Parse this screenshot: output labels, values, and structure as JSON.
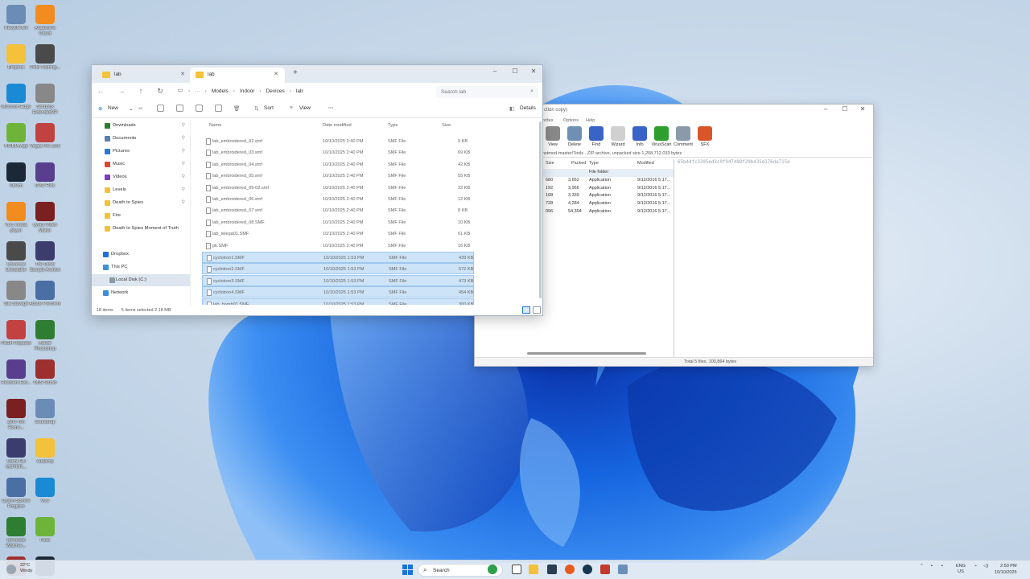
{
  "desktop": {
    "col1": [
      "Recycle Bin",
      "Dropbox",
      "Microsoft Edge",
      "NVIDIA App",
      "Steam",
      "VLC media player",
      "Universal Uninstaller",
      "Silk Salvage",
      "FitGirl Repacks",
      "Resident Evil...",
      "Zero Ton Rome...",
      "Silent Hill MOTOR...",
      "Dyson Sphere Program",
      "Universal Watcher...",
      "Lab/Thing Studio..."
    ],
    "col2": [
      "Assassin's Creed",
      "Field Training...",
      "Sandbox ExtendedVR",
      "Vegas Pro 20.0",
      "DVD Flick",
      "Lyrics Video Maker",
      "The Other Sample Archive",
      "Adobe Premiere",
      "Adobe Photoshop",
      "OBS Studio",
      "Soundtrap",
      "Audacity",
      "VLC",
      "Foxit",
      "Spotify"
    ]
  },
  "explorer": {
    "tabs": [
      {
        "label": "lab"
      },
      {
        "label": "lab"
      }
    ],
    "breadcrumbs": [
      "Models",
      "Indoor",
      "Devices",
      "lab"
    ],
    "search_placeholder": "Search lab",
    "toolbar": {
      "new": "New",
      "sort": "Sort",
      "view": "View",
      "details": "Details"
    },
    "nav": [
      {
        "label": "Downloads",
        "color": "#2e7d32",
        "pinned": true
      },
      {
        "label": "Documents",
        "color": "#5b7db1",
        "pinned": true
      },
      {
        "label": "Pictures",
        "color": "#2a78d4",
        "pinned": true
      },
      {
        "label": "Music",
        "color": "#e0452e",
        "pinned": true
      },
      {
        "label": "Videos",
        "color": "#7a3fc2",
        "pinned": true
      },
      {
        "label": "Levels",
        "color": "#f3c13a",
        "pinned": true
      },
      {
        "label": "Death to Spies",
        "color": "#f3c13a",
        "pinned": true
      },
      {
        "label": "Fire",
        "color": "#f3c13a",
        "pinned": false
      },
      {
        "label": "Death to Spies Moment of Truth",
        "color": "#f3c13a",
        "pinned": false
      },
      {
        "label": "Dropbox",
        "color": "#1f6fe0",
        "pinned": false
      },
      {
        "label": "This PC",
        "color": "#3c8ed8",
        "pinned": false
      },
      {
        "label": "Local Disk (C:)",
        "color": "#8a9aa8",
        "pinned": false
      },
      {
        "label": "Network",
        "color": "#3c8ed8",
        "pinned": false
      }
    ],
    "columns": {
      "name": "Name",
      "date": "Date modified",
      "type": "Type",
      "size": "Size"
    },
    "files": [
      {
        "name": "lab_embroidered_02.smf",
        "date": "10/10/2025 2:40 PM",
        "type": "SMF File",
        "size": "9 KB",
        "selected": false
      },
      {
        "name": "lab_embroidered_03.smf",
        "date": "10/10/2025 2:40 PM",
        "type": "SMF File",
        "size": "69 KB",
        "selected": false
      },
      {
        "name": "lab_embroidered_04.smf",
        "date": "10/10/2025 2:40 PM",
        "type": "SMF File",
        "size": "42 KB",
        "selected": false
      },
      {
        "name": "lab_embroidered_05.smf",
        "date": "10/10/2025 2:40 PM",
        "type": "SMF File",
        "size": "55 KB",
        "selected": false
      },
      {
        "name": "lab_embroidered_05-02.smf",
        "date": "10/10/2025 2:40 PM",
        "type": "SMF File",
        "size": "32 KB",
        "selected": false
      },
      {
        "name": "lab_embroidered_06.smf",
        "date": "10/10/2025 2:40 PM",
        "type": "SMF File",
        "size": "12 KB",
        "selected": false
      },
      {
        "name": "lab_embroidered_07.smf",
        "date": "10/10/2025 2:40 PM",
        "type": "SMF File",
        "size": "8 KB",
        "selected": false
      },
      {
        "name": "lab_embroidered_08.SMF",
        "date": "10/10/2025 2:40 PM",
        "type": "SMF File",
        "size": "10 KB",
        "selected": false
      },
      {
        "name": "lab_telega01.SMF",
        "date": "10/10/2025 2:40 PM",
        "type": "SMF File",
        "size": "61 KB",
        "selected": false
      },
      {
        "name": "pk.SMF",
        "date": "10/10/2025 2:40 PM",
        "type": "SMF File",
        "size": "16 KB",
        "selected": false
      },
      {
        "name": "cyclotron1.SMF",
        "date": "10/10/2025 1:53 PM",
        "type": "SMF File",
        "size": "439 KB",
        "selected": true
      },
      {
        "name": "cyclotron2.SMF",
        "date": "10/10/2025 1:53 PM",
        "type": "SMF File",
        "size": "572 KB",
        "selected": true
      },
      {
        "name": "cyclotron3.SMF",
        "date": "10/10/2025 1:53 PM",
        "type": "SMF File",
        "size": "473 KB",
        "selected": true
      },
      {
        "name": "cyclotron4.SMF",
        "date": "10/10/2025 1:53 PM",
        "type": "SMF File",
        "size": "454 KB",
        "selected": true
      },
      {
        "name": "lab_bomb01.SMF",
        "date": "10/10/2025 1:53 PM",
        "type": "SMF File",
        "size": "300 KB",
        "selected": true
      }
    ],
    "status": {
      "items": "18 items",
      "selected": "5 items selected  2.18 MB"
    }
  },
  "zip": {
    "title": "ction copy)",
    "menu": [
      "orites",
      "Options",
      "Help"
    ],
    "tools": [
      {
        "label": "View",
        "color": "#8a8a8a"
      },
      {
        "label": "Delete",
        "color": "#6f8fb5"
      },
      {
        "label": "Find",
        "color": "#3a63c8"
      },
      {
        "label": "Wizard",
        "color": "#d0d0d0"
      },
      {
        "label": "Info",
        "color": "#3a63c8"
      },
      {
        "label": "VirusScan",
        "color": "#2e9e2e"
      },
      {
        "label": "Comment",
        "color": "#8a9aa8"
      },
      {
        "label": "SFX",
        "color": "#d9562b"
      }
    ],
    "address": "nstmod-master/Tools - ZIP archive, unpacked size 1,208,712,033 bytes",
    "columns": {
      "size": "Size",
      "packed": "Packed",
      "type": "Type",
      "modified": "Modified"
    },
    "rows": [
      {
        "size": "",
        "packed": "",
        "type": "File folder",
        "modified": ""
      },
      {
        "size": "680",
        "packed": "3,652",
        "type": "Application",
        "modified": "9/12/2016 5:17..."
      },
      {
        "size": "192",
        "packed": "3,966",
        "type": "Application",
        "modified": "9/12/2016 5:17..."
      },
      {
        "size": "168",
        "packed": "3,330",
        "type": "Application",
        "modified": "9/12/2016 5:17..."
      },
      {
        "size": "728",
        "packed": "4,284",
        "type": "Application",
        "modified": "9/12/2016 5:17..."
      },
      {
        "size": "096",
        "packed": "54,394",
        "type": "Application",
        "modified": "9/12/2016 5:17..."
      }
    ],
    "hash": "65b44fc3395ed3c0f947489f29bd35d176da715e",
    "status": "Total 5 files, 100,864 bytes"
  },
  "taskbar": {
    "weather_temp": "22°C",
    "weather_desc": "Windy",
    "search": "Search",
    "lang1": "ENG",
    "lang2": "US",
    "time": "2:50 PM",
    "date": "10/10/2025"
  }
}
